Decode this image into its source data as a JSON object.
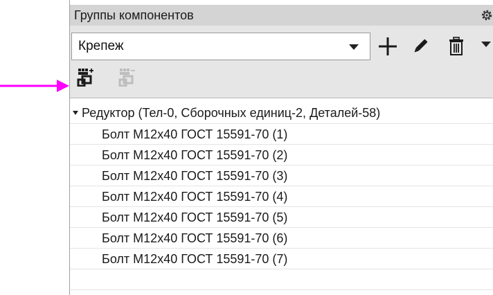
{
  "panel": {
    "title": "Группы компонентов",
    "settings_icon": "gear-icon"
  },
  "group_selector": {
    "value": "Крепеж",
    "dropdown_icon": "chevron-down-icon"
  },
  "group_toolbar": {
    "add_icon": "plus-icon",
    "edit_icon": "pencil-icon",
    "delete_icon": "trash-icon",
    "more_icon": "chevron-down-icon"
  },
  "component_toolbar": {
    "add_to_group_icon": "add-components-icon",
    "remove_from_group_icon": "remove-components-icon",
    "remove_enabled": false
  },
  "annotation": {
    "arrow_color": "#ff00ff"
  },
  "tree": {
    "root_label": "Редуктор (Тел-0, Сборочных единиц-2, Деталей-58)",
    "expanded": true,
    "items": [
      "Болт М12х40 ГОСТ 15591-70 (1)",
      "Болт М12х40 ГОСТ 15591-70 (2)",
      "Болт М12х40 ГОСТ 15591-70 (3)",
      "Болт М12х40 ГОСТ 15591-70 (4)",
      "Болт М12х40 ГОСТ 15591-70 (5)",
      "Болт М12х40 ГОСТ 15591-70 (6)",
      "Болт М12х40 ГОСТ 15591-70 (7)"
    ]
  }
}
